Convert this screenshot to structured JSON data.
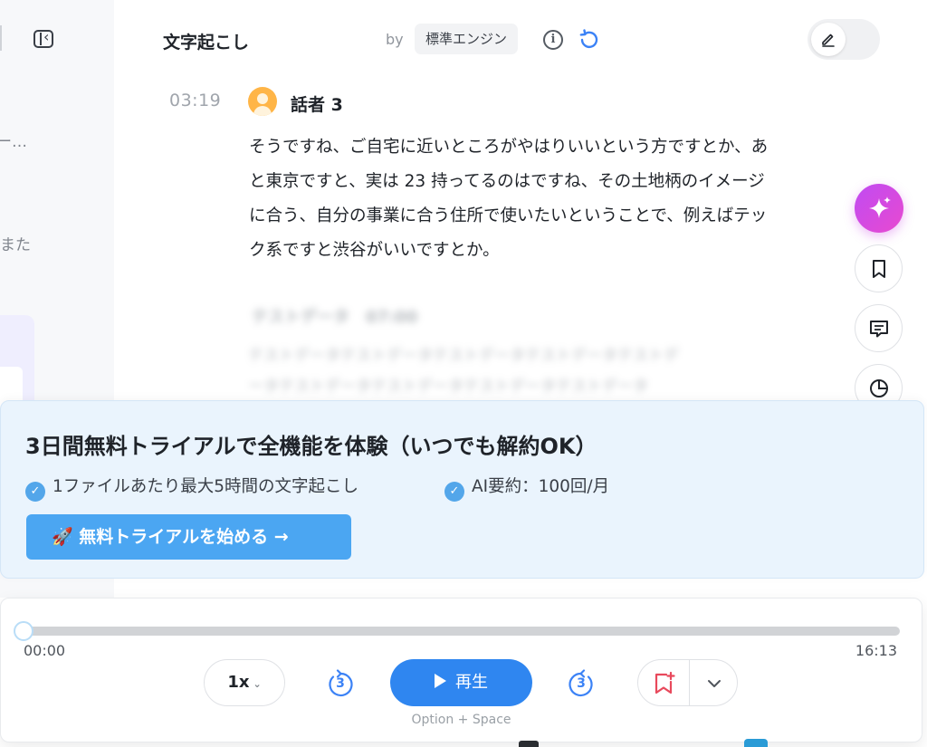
{
  "sidebar": {
    "snippet_1": "ー…",
    "snippet_2": "また"
  },
  "header": {
    "title": "文字起こし",
    "by_label": "by",
    "engine_label": "標準エンジン"
  },
  "transcript": {
    "timestamp": "03:19",
    "speaker": "話者 3",
    "text": "そうですね、ご自宅に近いところがやはりいいという方ですとか、あと東京ですと、実は 23 持ってるのはですね、その土地柄のイメージに合う、自分の事業に合う住所で使いたいということで、例えばテック系ですと渋谷がいいですとか。",
    "blurred_heading": "テストデータ　07:00",
    "blurred_line_1": "テストデータテストデータテストデータテストデータテストデ",
    "blurred_line_2": "ータテストデータテストデータテストデータテストデータ"
  },
  "trial": {
    "title": "3日間無料トライアルで全機能を体験（いつでも解約OK）",
    "feature_1": "1ファイルあたり最大5時間の文字起こし",
    "feature_2": "AI要約：100回/月",
    "cta_label": "🚀 無料トライアルを始める →"
  },
  "player": {
    "current_time": "00:00",
    "duration": "16:13",
    "progress": 0,
    "speed_label": "1x",
    "skip_back_seconds": "3",
    "skip_forward_seconds": "3",
    "play_label": "再生",
    "shortcut_hint": "Option + Space"
  },
  "colors": {
    "accent": "#2f86f0",
    "ai_gradient_start": "#c04bf2",
    "ai_gradient_end": "#e84ad0",
    "trial_bg": "#eaf4fd",
    "cta_bg": "#4ba6f2",
    "bookmark_red": "#e8495c"
  }
}
